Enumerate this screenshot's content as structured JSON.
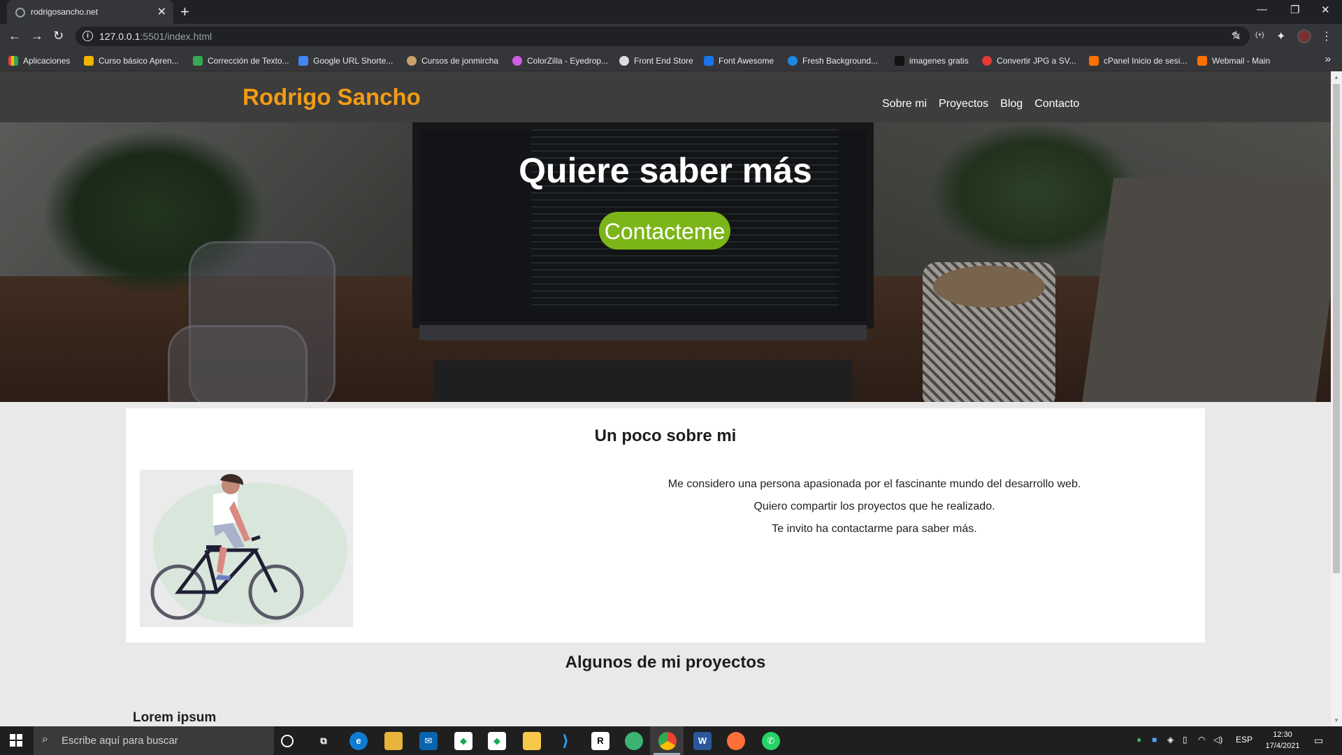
{
  "browser": {
    "tab_title": "rodrigosancho.net",
    "tab_close": "✕",
    "new_tab": "+",
    "url_host": "127.0.0.1",
    "url_rest": ":5501/index.html",
    "bookmarks": [
      {
        "label": "Aplicaciones",
        "color": "#ea4335"
      },
      {
        "label": "Curso básico Apren...",
        "color": "#f4b400"
      },
      {
        "label": "Corrección de Texto...",
        "color": "#34a853"
      },
      {
        "label": "Google URL Shorte...",
        "color": "#4285f4"
      },
      {
        "label": "Cursos de jonmircha",
        "color": "#c8a06a"
      },
      {
        "label": "ColorZilla - Eyedrop...",
        "color": "#d05ce3"
      },
      {
        "label": "Front End Store",
        "color": "#444444"
      },
      {
        "label": "Font Awesome",
        "color": "#1a73e8"
      },
      {
        "label": "Fresh Background...",
        "color": "#1e88e5"
      },
      {
        "label": "imagenes gratis",
        "color": "#222222"
      },
      {
        "label": "Convertir JPG a SV...",
        "color": "#e53935"
      },
      {
        "label": "cPanel Inicio de sesi...",
        "color": "#ff6f00"
      },
      {
        "label": "Webmail - Main",
        "color": "#ff6f00"
      }
    ],
    "bookmarks_more": "»"
  },
  "site": {
    "logo": "Rodrigo Sancho",
    "logo_color": "#f39c12",
    "nav": [
      "Sobre mi",
      "Proyectos",
      "Blog",
      "Contacto"
    ],
    "hero": {
      "title": "Quiere saber más",
      "button": "Contacteme",
      "button_color": "#7cb518"
    },
    "about": {
      "title": "Un poco sobre mi",
      "paragraphs": [
        "Me considero una persona apasionada por el fascinante mundo del desarrollo web.",
        "Quiero compartir los proyectos que he realizado.",
        "Te invito ha contactarme para saber más."
      ]
    },
    "projects": {
      "title": "Algunos de mi proyectos",
      "first_item_title": "Lorem ipsum"
    }
  },
  "taskbar": {
    "search_placeholder": "Escribe aquí para buscar",
    "language": "ESP",
    "time": "12:30",
    "date": "17/4/2021"
  }
}
